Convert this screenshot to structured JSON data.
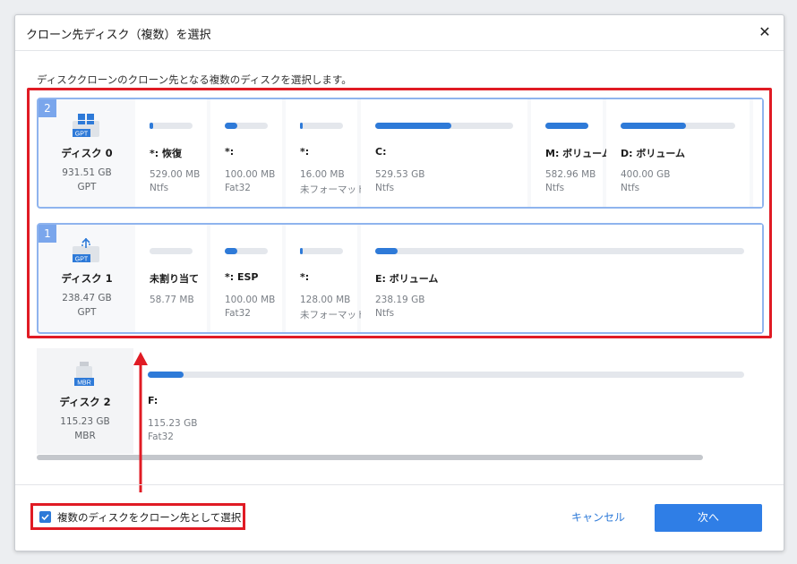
{
  "dialog": {
    "title": "クローン先ディスク（複数）を選択",
    "close_label": "✕",
    "instruction": "ディスククローンのクローン先となる複数のディスクを選択します。"
  },
  "disks": [
    {
      "order": "2",
      "icon": "windows-gpt-disk-icon",
      "badge": "GPT",
      "name": "ディスク 0",
      "size": "931.51 GB",
      "style": "GPT",
      "selected": true,
      "partitions": [
        {
          "name": "*: 恢復",
          "size": "529.00 MB",
          "fs": "Ntfs",
          "fill": 0.08
        },
        {
          "name": "*:",
          "size": "100.00 MB",
          "fs": "Fat32",
          "fill": 0.3
        },
        {
          "name": "*:",
          "size": "16.00 MB",
          "fs": "未フォーマット",
          "fill": 0.05
        },
        {
          "name": "C:",
          "size": "529.53 GB",
          "fs": "Ntfs",
          "fill": 0.55
        },
        {
          "name": "M: ボリューム",
          "size": "582.96 MB",
          "fs": "Ntfs",
          "fill": 1.0
        },
        {
          "name": "D: ボリューム",
          "size": "400.00 GB",
          "fs": "Ntfs",
          "fill": 0.57
        }
      ]
    },
    {
      "order": "1",
      "icon": "usb-gpt-disk-icon",
      "badge": "GPT",
      "name": "ディスク 1",
      "size": "238.47 GB",
      "style": "GPT",
      "selected": true,
      "partitions": [
        {
          "name": "未割り当て",
          "size": "58.77 MB",
          "fs": "",
          "fill": 0.0
        },
        {
          "name": "*: ESP",
          "size": "100.00 MB",
          "fs": "Fat32",
          "fill": 0.3
        },
        {
          "name": "*:",
          "size": "128.00 MB",
          "fs": "未フォーマット",
          "fill": 0.05
        },
        {
          "name": "E: ボリューム",
          "size": "238.19 GB",
          "fs": "Ntfs",
          "fill": 0.01
        }
      ]
    },
    {
      "order": "",
      "icon": "usb-mbr-disk-icon",
      "badge": "MBR",
      "name": "ディスク 2",
      "size": "115.23 GB",
      "style": "MBR",
      "selected": false,
      "partitions": [
        {
          "name": "F:",
          "size": "115.23 GB",
          "fs": "Fat32",
          "fill": 0.01
        }
      ]
    }
  ],
  "footer": {
    "multi_checkbox_label": "複数のディスクをクローン先として選択",
    "multi_checked": true,
    "cancel_label": "キャンセル",
    "next_label": "次へ"
  },
  "colors": {
    "accent": "#2e7ad8",
    "highlight": "#e01b24",
    "selected_border": "#8fb4ee"
  }
}
